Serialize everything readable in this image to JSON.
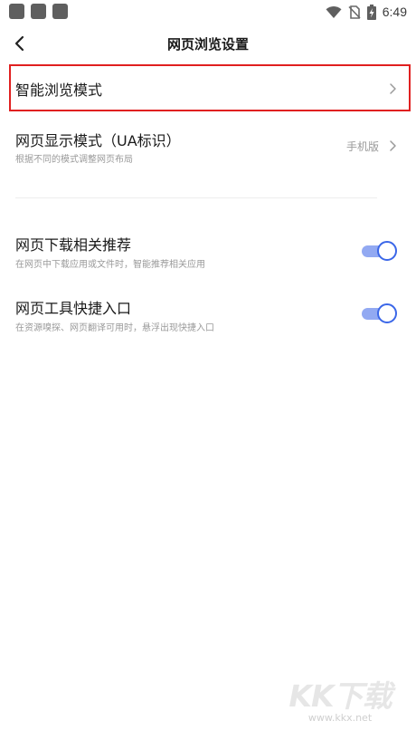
{
  "status_bar": {
    "time": "6:49",
    "icons": [
      "app-notification-icon",
      "app-notification-icon",
      "app-notification-icon",
      "wifi-icon",
      "no-sim-icon",
      "battery-charging-icon"
    ]
  },
  "header": {
    "title": "网页浏览设置",
    "back_icon": "chevron-left-icon"
  },
  "settings": [
    {
      "title": "智能浏览模式",
      "type": "link"
    },
    {
      "title": "网页显示模式（UA标识）",
      "subtitle": "根据不同的模式调整网页布局",
      "value": "手机版",
      "type": "link"
    },
    {
      "title": "网页下载相关推荐",
      "subtitle": "在网页中下载应用或文件时，智能推荐相关应用",
      "type": "toggle",
      "enabled": true
    },
    {
      "title": "网页工具快捷入口",
      "subtitle": "在资源嗅探、网页翻译可用时，悬浮出现快捷入口",
      "type": "toggle",
      "enabled": true
    }
  ],
  "colors": {
    "toggle_on_knob": "#3b67e8",
    "toggle_on_track": "#92a9f2",
    "highlight_border": "#e02020"
  },
  "watermark": {
    "logo_text": "KK下载",
    "url": "www.kkx.net"
  }
}
